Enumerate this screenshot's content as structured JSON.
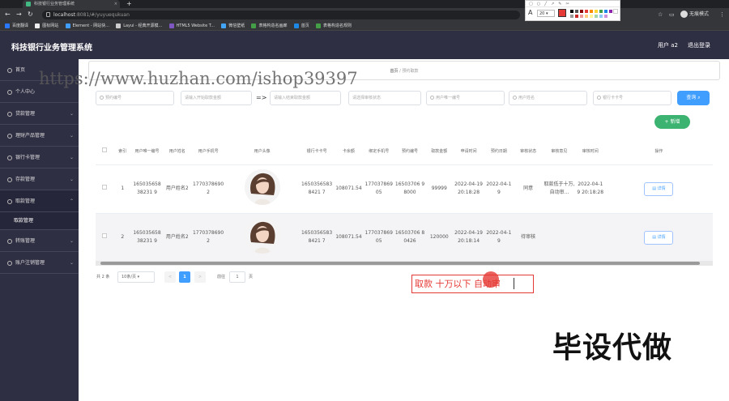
{
  "browser": {
    "tab_title": "科技银行业务管理系统",
    "url_host": "localhost",
    "url_path": ":8081/#/yuyuequkuan",
    "profile_label": "无痕模式",
    "bookmarks": [
      "百度翻译",
      "图标网站",
      "Element - 网站快...",
      "Layui - 经典开源模...",
      "HTML5 Website T...",
      "微信壁纸",
      "表格构造名画廊",
      "首页",
      "表格构造名规则"
    ]
  },
  "annotation_toolbar": {
    "font_size": "20"
  },
  "app": {
    "title": "科技银行业务管理系统",
    "user": "用户 a2",
    "logout": "退出登录"
  },
  "sidebar": {
    "items": [
      {
        "label": "首页"
      },
      {
        "label": "个人中心"
      },
      {
        "label": "贷款管理"
      },
      {
        "label": "理财产品管理"
      },
      {
        "label": "银行卡管理"
      },
      {
        "label": "存款管理"
      },
      {
        "label": "取款管理"
      },
      {
        "label": "转账管理"
      },
      {
        "label": "账户注销管理"
      }
    ],
    "sub_item": "取款管理"
  },
  "breadcrumb": {
    "home": "首页",
    "current": "预约取款"
  },
  "filters": {
    "f1": "预约编号",
    "f2": "请输入开始取款金额",
    "swap": "=>",
    "f3": "请输入结束取款金额",
    "f4": "请选择审核状态",
    "f5": "用户唯一编号",
    "f6": "用户姓名",
    "f7": "银行卡卡号",
    "query": "查询",
    "add": "+ 新增"
  },
  "table": {
    "headers": [
      "",
      "索引",
      "用户唯一编号",
      "用户姓名",
      "用户手机号",
      "用户头像",
      "银行卡卡号",
      "卡余额",
      "绑定手机号",
      "预约编号",
      "取款金额",
      "申请时间",
      "预约日期",
      "审核状态",
      "审核意见",
      "审核时间",
      "操作"
    ],
    "rows": [
      {
        "index": "1",
        "uid": "16503565838231 9",
        "name": "用户姓名2",
        "phone": "17703786902",
        "card": "16503565838421 7",
        "balance": "108071.54",
        "bind_phone": "17703786905",
        "order": "16503706 98000",
        "amount": "99999",
        "apply_time": "2022-04-19 20:18:28",
        "date": "2022-04-19",
        "status": "同意",
        "opinion": "取款低于十万,自动审...",
        "review_time": "2022-04-19 20:18:28",
        "action": "详情"
      },
      {
        "index": "2",
        "uid": "16503565838231 9",
        "name": "用户姓名2",
        "phone": "17703786902",
        "card": "16503565838421 7",
        "balance": "108071.54",
        "bind_phone": "17703786905",
        "order": "16503706 80426",
        "amount": "120000",
        "apply_time": "2022-04-19 20:18:14",
        "date": "2022-04-19",
        "status": "待审核",
        "opinion": "",
        "review_time": "",
        "action": "详情"
      }
    ]
  },
  "pager": {
    "total": "共 2 条",
    "page_size": "10条/页",
    "prev": "<",
    "current": "1",
    "next": ">",
    "goto_label": "前往",
    "goto_value": "1",
    "goto_suffix": "页"
  },
  "annotation_text": "取款 十万以下 自动审",
  "watermark": "https://www.huzhan.com/ishop39397",
  "overlay_caption": "毕设代做"
}
